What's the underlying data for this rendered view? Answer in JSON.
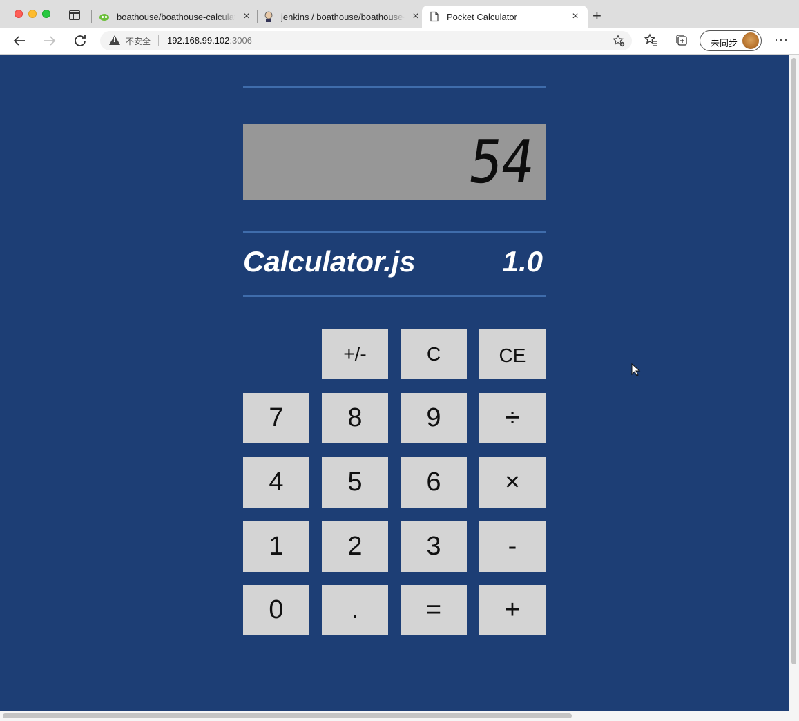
{
  "browser": {
    "tabs": [
      {
        "title": "boathouse/boathouse-calculator",
        "close": "×"
      },
      {
        "title": "jenkins / boathouse/boathouse-calculator",
        "close": "×"
      },
      {
        "title": "Pocket Calculator",
        "close": "×"
      }
    ],
    "new_tab": "+",
    "security_label": "不安全",
    "url_host": "192.168.99.102",
    "url_port": ":3006",
    "profile_label": "未同步",
    "more": "···"
  },
  "calculator": {
    "display": "54",
    "brand": "Calculator.js",
    "version": "1.0",
    "keys": {
      "negate": "+/-",
      "clear": "C",
      "clear_entry": "CE",
      "seven": "7",
      "eight": "8",
      "nine": "9",
      "divide": "÷",
      "four": "4",
      "five": "5",
      "six": "6",
      "multiply": "×",
      "one": "1",
      "two": "2",
      "three": "3",
      "subtract": "-",
      "zero": "0",
      "decimal": ".",
      "equals": "=",
      "add": "+"
    }
  },
  "colors": {
    "page_background": "#1d3e75",
    "rule": "#3f6cab",
    "display_background": "#979797",
    "key_background": "#d4d4d4"
  }
}
